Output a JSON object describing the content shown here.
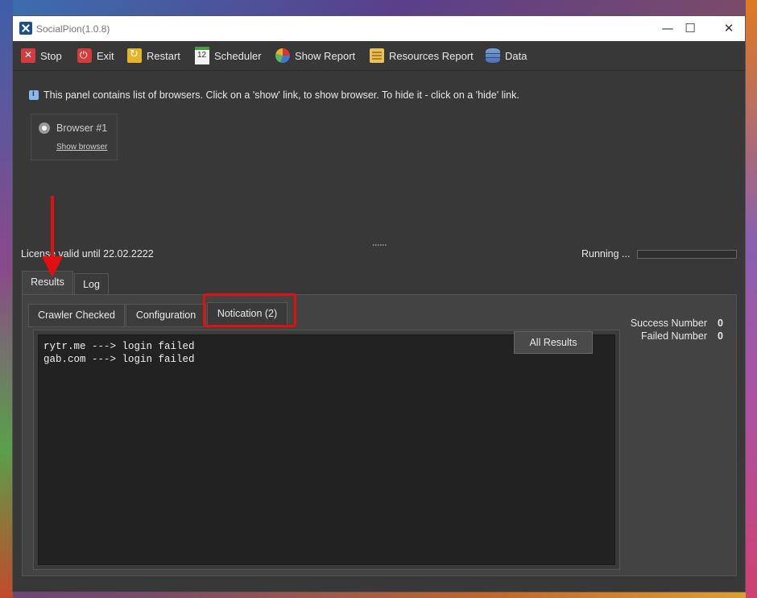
{
  "window": {
    "title": "SocialPion(1.0.8)"
  },
  "toolbar": {
    "stop": "Stop",
    "exit": "Exit",
    "restart": "Restart",
    "scheduler": "Scheduler",
    "show_report": "Show Report",
    "resources_report": "Resources Report",
    "data": "Data"
  },
  "info_text": "This panel contains list of browsers. Click on a 'show' link, to show browser. To hide it - click on a 'hide' link.",
  "browsers": [
    {
      "name": "Browser #1",
      "link": "Show browser"
    }
  ],
  "status": {
    "license": "License valid until 22.02.2222",
    "running": "Running ..."
  },
  "outer_tabs": [
    "Results",
    "Log"
  ],
  "inner_tabs": [
    "Crawler Checked",
    "Configuration",
    "Notication (2)"
  ],
  "console_lines": [
    "rytr.me ---> login failed",
    "gab.com ---> login failed"
  ],
  "all_results_label": "All Results",
  "stats": {
    "success_label": "Success Number",
    "success_value": "0",
    "failed_label": "Failed Number",
    "failed_value": "0"
  },
  "annotation_color": "#e01010"
}
